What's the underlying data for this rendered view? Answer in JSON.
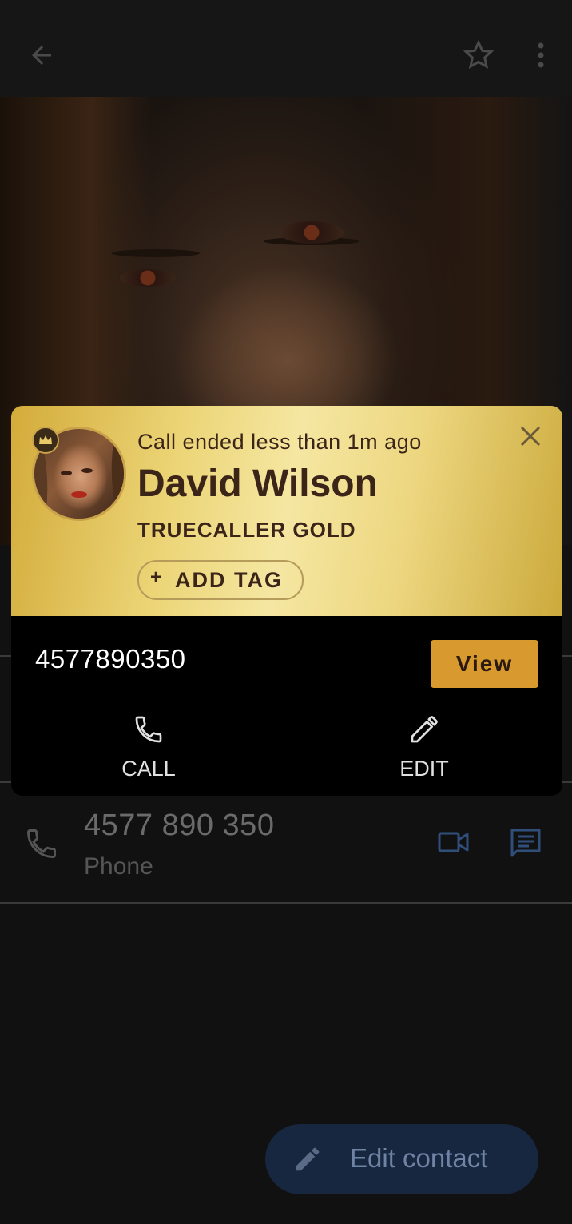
{
  "appbar": {
    "back_icon": "arrow-back-icon",
    "star_icon": "star-outline-icon",
    "menu_icon": "more-vert-icon"
  },
  "contact": {
    "phone_number": "4577 890 350",
    "phone_type": "Phone",
    "video_icon": "video-call-icon",
    "message_icon": "message-icon"
  },
  "fab": {
    "label": "Edit contact",
    "icon": "pencil-icon",
    "color": "#16273f"
  },
  "caller_card": {
    "subtitle": "Call ended less than 1m ago",
    "name": "David Wilson",
    "tier": "TRUECALLER GOLD",
    "add_tag_plus": "+",
    "add_tag_label": "ADD TAG",
    "number": "4577890350",
    "view_label": "View",
    "view_color": "#d89a2f",
    "actions": [
      {
        "label": "CALL",
        "icon": "phone-icon"
      },
      {
        "label": "EDIT",
        "icon": "pencil-icon"
      }
    ]
  }
}
